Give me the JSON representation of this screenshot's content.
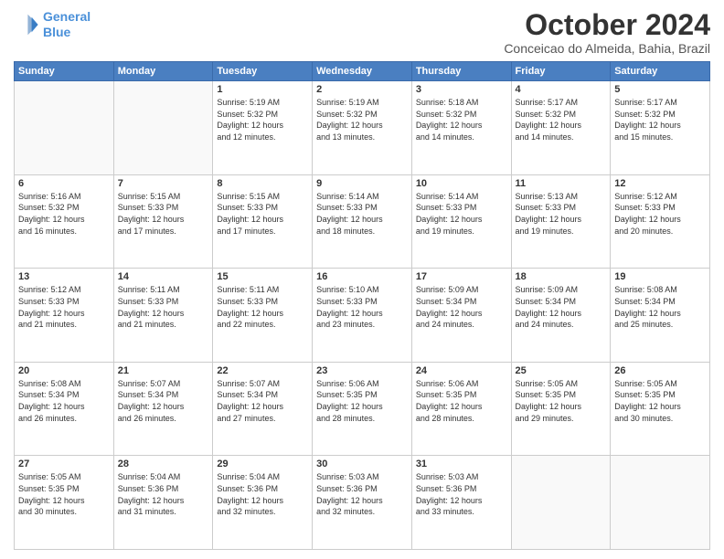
{
  "logo": {
    "line1": "General",
    "line2": "Blue"
  },
  "title": "October 2024",
  "location": "Conceicao do Almeida, Bahia, Brazil",
  "weekdays": [
    "Sunday",
    "Monday",
    "Tuesday",
    "Wednesday",
    "Thursday",
    "Friday",
    "Saturday"
  ],
  "weeks": [
    [
      {
        "day": "",
        "info": ""
      },
      {
        "day": "",
        "info": ""
      },
      {
        "day": "1",
        "info": "Sunrise: 5:19 AM\nSunset: 5:32 PM\nDaylight: 12 hours\nand 12 minutes."
      },
      {
        "day": "2",
        "info": "Sunrise: 5:19 AM\nSunset: 5:32 PM\nDaylight: 12 hours\nand 13 minutes."
      },
      {
        "day": "3",
        "info": "Sunrise: 5:18 AM\nSunset: 5:32 PM\nDaylight: 12 hours\nand 14 minutes."
      },
      {
        "day": "4",
        "info": "Sunrise: 5:17 AM\nSunset: 5:32 PM\nDaylight: 12 hours\nand 14 minutes."
      },
      {
        "day": "5",
        "info": "Sunrise: 5:17 AM\nSunset: 5:32 PM\nDaylight: 12 hours\nand 15 minutes."
      }
    ],
    [
      {
        "day": "6",
        "info": "Sunrise: 5:16 AM\nSunset: 5:32 PM\nDaylight: 12 hours\nand 16 minutes."
      },
      {
        "day": "7",
        "info": "Sunrise: 5:15 AM\nSunset: 5:33 PM\nDaylight: 12 hours\nand 17 minutes."
      },
      {
        "day": "8",
        "info": "Sunrise: 5:15 AM\nSunset: 5:33 PM\nDaylight: 12 hours\nand 17 minutes."
      },
      {
        "day": "9",
        "info": "Sunrise: 5:14 AM\nSunset: 5:33 PM\nDaylight: 12 hours\nand 18 minutes."
      },
      {
        "day": "10",
        "info": "Sunrise: 5:14 AM\nSunset: 5:33 PM\nDaylight: 12 hours\nand 19 minutes."
      },
      {
        "day": "11",
        "info": "Sunrise: 5:13 AM\nSunset: 5:33 PM\nDaylight: 12 hours\nand 19 minutes."
      },
      {
        "day": "12",
        "info": "Sunrise: 5:12 AM\nSunset: 5:33 PM\nDaylight: 12 hours\nand 20 minutes."
      }
    ],
    [
      {
        "day": "13",
        "info": "Sunrise: 5:12 AM\nSunset: 5:33 PM\nDaylight: 12 hours\nand 21 minutes."
      },
      {
        "day": "14",
        "info": "Sunrise: 5:11 AM\nSunset: 5:33 PM\nDaylight: 12 hours\nand 21 minutes."
      },
      {
        "day": "15",
        "info": "Sunrise: 5:11 AM\nSunset: 5:33 PM\nDaylight: 12 hours\nand 22 minutes."
      },
      {
        "day": "16",
        "info": "Sunrise: 5:10 AM\nSunset: 5:33 PM\nDaylight: 12 hours\nand 23 minutes."
      },
      {
        "day": "17",
        "info": "Sunrise: 5:09 AM\nSunset: 5:34 PM\nDaylight: 12 hours\nand 24 minutes."
      },
      {
        "day": "18",
        "info": "Sunrise: 5:09 AM\nSunset: 5:34 PM\nDaylight: 12 hours\nand 24 minutes."
      },
      {
        "day": "19",
        "info": "Sunrise: 5:08 AM\nSunset: 5:34 PM\nDaylight: 12 hours\nand 25 minutes."
      }
    ],
    [
      {
        "day": "20",
        "info": "Sunrise: 5:08 AM\nSunset: 5:34 PM\nDaylight: 12 hours\nand 26 minutes."
      },
      {
        "day": "21",
        "info": "Sunrise: 5:07 AM\nSunset: 5:34 PM\nDaylight: 12 hours\nand 26 minutes."
      },
      {
        "day": "22",
        "info": "Sunrise: 5:07 AM\nSunset: 5:34 PM\nDaylight: 12 hours\nand 27 minutes."
      },
      {
        "day": "23",
        "info": "Sunrise: 5:06 AM\nSunset: 5:35 PM\nDaylight: 12 hours\nand 28 minutes."
      },
      {
        "day": "24",
        "info": "Sunrise: 5:06 AM\nSunset: 5:35 PM\nDaylight: 12 hours\nand 28 minutes."
      },
      {
        "day": "25",
        "info": "Sunrise: 5:05 AM\nSunset: 5:35 PM\nDaylight: 12 hours\nand 29 minutes."
      },
      {
        "day": "26",
        "info": "Sunrise: 5:05 AM\nSunset: 5:35 PM\nDaylight: 12 hours\nand 30 minutes."
      }
    ],
    [
      {
        "day": "27",
        "info": "Sunrise: 5:05 AM\nSunset: 5:35 PM\nDaylight: 12 hours\nand 30 minutes."
      },
      {
        "day": "28",
        "info": "Sunrise: 5:04 AM\nSunset: 5:36 PM\nDaylight: 12 hours\nand 31 minutes."
      },
      {
        "day": "29",
        "info": "Sunrise: 5:04 AM\nSunset: 5:36 PM\nDaylight: 12 hours\nand 32 minutes."
      },
      {
        "day": "30",
        "info": "Sunrise: 5:03 AM\nSunset: 5:36 PM\nDaylight: 12 hours\nand 32 minutes."
      },
      {
        "day": "31",
        "info": "Sunrise: 5:03 AM\nSunset: 5:36 PM\nDaylight: 12 hours\nand 33 minutes."
      },
      {
        "day": "",
        "info": ""
      },
      {
        "day": "",
        "info": ""
      }
    ]
  ]
}
